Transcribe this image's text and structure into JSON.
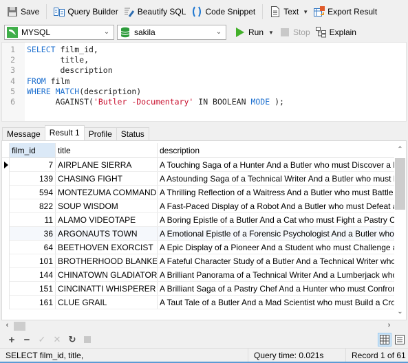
{
  "toolbar": {
    "save": "Save",
    "query_builder": "Query Builder",
    "beautify_sql": "Beautify SQL",
    "code_snippet": "Code Snippet",
    "text": "Text",
    "export_result": "Export Result"
  },
  "connection_bar": {
    "connection": "MYSQL",
    "database": "sakila",
    "run": "Run",
    "stop": "Stop",
    "explain": "Explain"
  },
  "editor": {
    "line_numbers": [
      "1",
      "2",
      "3",
      "4",
      "5",
      "6"
    ],
    "lines": [
      {
        "kw1": "SELECT",
        "text": " film_id,"
      },
      {
        "indent": "       ",
        "text": "title,"
      },
      {
        "indent": "       ",
        "text": "description"
      },
      {
        "kw1": "FROM",
        "text": " film"
      },
      {
        "kw1": "WHERE",
        "kw2": "MATCH",
        "text": "(description)"
      },
      {
        "indent": "      ",
        "fn": "AGAINST(",
        "str": "'Butler -Documentary'",
        "kw3": " IN BOOLEAN ",
        "kw4": "MODE",
        "tail": " );"
      }
    ]
  },
  "result_tabs": [
    "Message",
    "Result 1",
    "Profile",
    "Status"
  ],
  "active_tab": "Result 1",
  "grid": {
    "columns": [
      "film_id",
      "title",
      "description"
    ],
    "rows": [
      {
        "film_id": "7",
        "title": "AIRPLANE SIERRA",
        "description": "A Touching Saga of a Hunter And a Butler who must Discover a Butler"
      },
      {
        "film_id": "139",
        "title": "CHASING FIGHT",
        "description": "A Astounding Saga of a Technical Writer And a Butler who must Battle"
      },
      {
        "film_id": "594",
        "title": "MONTEZUMA COMMAND",
        "description": "A Thrilling Reflection of a Waitress And a Butler who must Battle a"
      },
      {
        "film_id": "822",
        "title": "SOUP WISDOM",
        "description": "A Fast-Paced Display of a Robot And a Butler who must Defeat a Butler"
      },
      {
        "film_id": "11",
        "title": "ALAMO VIDEOTAPE",
        "description": "A Boring Epistle of a Butler And a Cat who must Fight a Pastry Chef"
      },
      {
        "film_id": "36",
        "title": "ARGONAUTS TOWN",
        "description": "A Emotional Epistle of a Forensic Psychologist And a Butler who must"
      },
      {
        "film_id": "64",
        "title": "BEETHOVEN EXORCIST",
        "description": "A Epic Display of a Pioneer And a Student who must Challenge a Butler"
      },
      {
        "film_id": "101",
        "title": "BROTHERHOOD BLANKET",
        "description": "A Fateful Character Study of a Butler And a Technical Writer who must"
      },
      {
        "film_id": "144",
        "title": "CHINATOWN GLADIATOR",
        "description": "A Brilliant Panorama of a Technical Writer And a Lumberjack who must"
      },
      {
        "film_id": "151",
        "title": "CINCINATTI WHISPERER",
        "description": "A Brilliant Saga of a Pastry Chef And a Hunter who must Confront a"
      },
      {
        "film_id": "161",
        "title": "CLUE GRAIL",
        "description": "A Taut Tale of a Butler And a Mad Scientist who must Build a Crocodile"
      }
    ]
  },
  "status_bar": {
    "sql_preview": "SELECT film_id,       title,",
    "query_time": "Query time: 0.021s",
    "record": "Record 1 of 61"
  }
}
